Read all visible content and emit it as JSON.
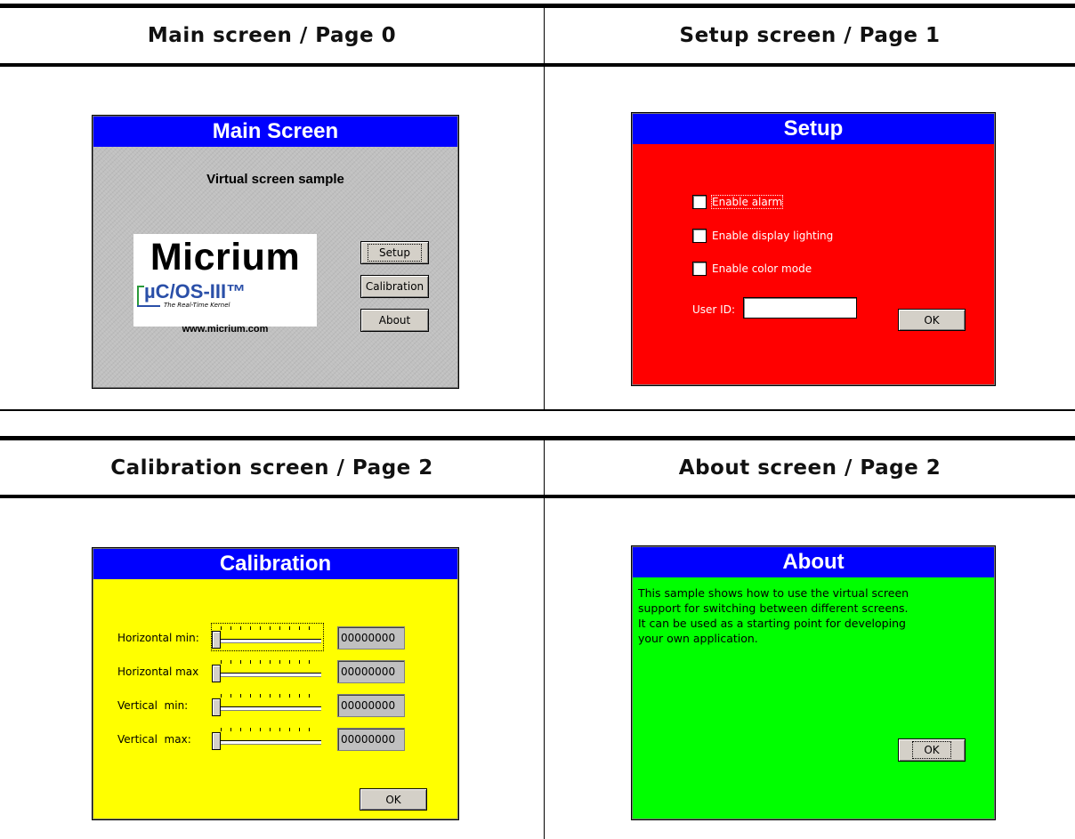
{
  "cells": {
    "main_header": "Main screen / Page 0",
    "setup_header": "Setup screen / Page 1",
    "calib_header": "Calibration screen / Page 2",
    "about_header": "About screen / Page 2"
  },
  "main_window": {
    "title": "Main Screen",
    "subtitle": "Virtual screen sample",
    "logo": {
      "brand": "Micrium",
      "product": "µC/OS-III™",
      "tagline": "The Real-Time Kernel",
      "url": "www.micrium.com"
    },
    "buttons": {
      "setup": "Setup",
      "calibration": "Calibration",
      "about": "About"
    }
  },
  "setup_window": {
    "title": "Setup",
    "checkboxes": [
      "Enable alarm",
      "Enable display lighting",
      "Enable color mode"
    ],
    "user_id_label": "User ID:",
    "user_id_value": "",
    "ok": "OK"
  },
  "calib_window": {
    "title": "Calibration",
    "rows": [
      {
        "label": "Horizontal min:",
        "value": "00000000",
        "slider": 0
      },
      {
        "label": "Horizontal max",
        "value": "00000000",
        "slider": 0
      },
      {
        "label": "Vertical  min:",
        "value": "00000000",
        "slider": 0
      },
      {
        "label": "Vertical  max:",
        "value": "00000000",
        "slider": 0
      }
    ],
    "ok": "OK"
  },
  "about_window": {
    "title": "About",
    "text_lines": [
      "This sample shows how to use the virtual screen",
      "support for switching between different screens.",
      "It can be used as a starting point for developing",
      "your own application."
    ],
    "ok": "OK"
  },
  "colors": {
    "title_bar": "#0000ff",
    "setup_bg": "#ff0000",
    "calib_bg": "#ffff00",
    "about_bg": "#00ff00",
    "main_bg": "#c0c0c0"
  }
}
